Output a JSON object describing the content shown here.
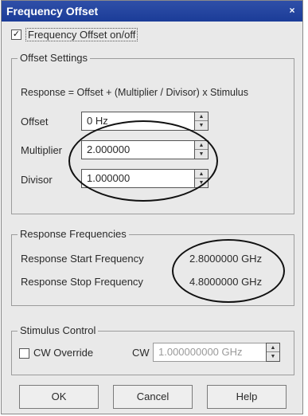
{
  "window": {
    "title": "Frequency Offset",
    "close_label": "×"
  },
  "enable": {
    "label": "Frequency Offset on/off",
    "checked_mark": "✓"
  },
  "offset_settings": {
    "group_title": "Offset Settings",
    "formula": "Response  =  Offset + (Multiplier / Divisor) x Stimulus",
    "offset_label": "Offset",
    "offset_value": "0 Hz",
    "multiplier_label": "Multiplier",
    "multiplier_value": "2.000000",
    "divisor_label": "Divisor",
    "divisor_value": "1.000000"
  },
  "response_frequencies": {
    "group_title": "Response Frequencies",
    "start_label": "Response Start Frequency",
    "start_value": "2.8000000 GHz",
    "stop_label": "Response Stop Frequency",
    "stop_value": "4.8000000 GHz"
  },
  "stimulus_control": {
    "group_title": "Stimulus Control",
    "cw_override_label": "CW Override",
    "cw_label": "CW",
    "cw_value": "1.000000000 GHz"
  },
  "buttons": {
    "ok": "OK",
    "cancel": "Cancel",
    "help": "Help"
  }
}
